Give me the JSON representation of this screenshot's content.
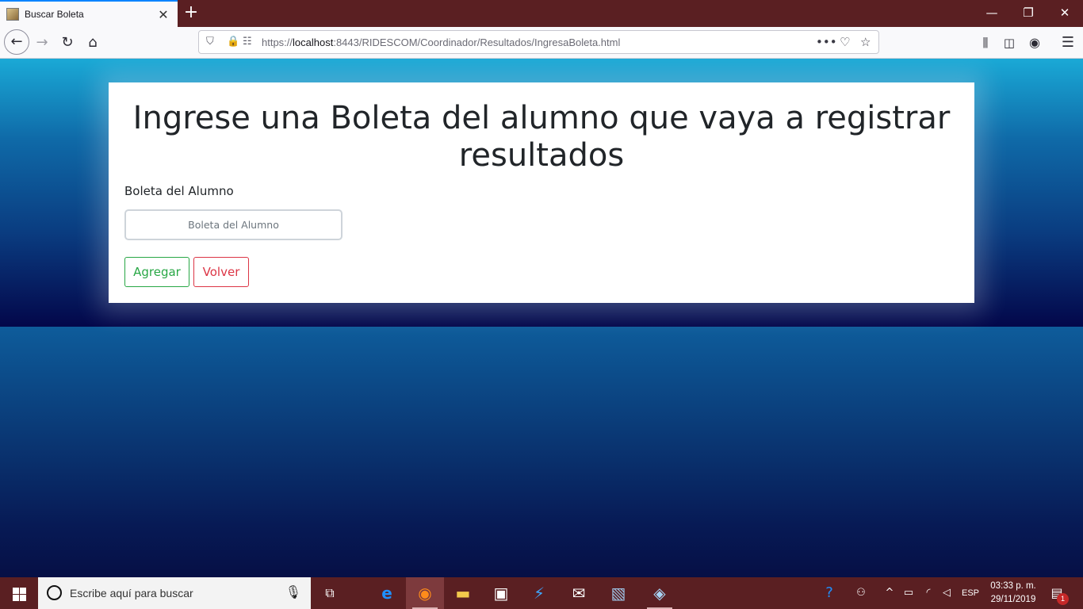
{
  "browser": {
    "tab_title": "Buscar Boleta",
    "tab_close": "✕",
    "new_tab": "+",
    "url_prefix": "https://",
    "url_host": "localhost",
    "url_rest": ":8443/RIDESCOM/Coordinador/Resultados/IngresaBoleta.html",
    "window_controls": {
      "minimize": "—",
      "restore": "❐",
      "close": "✕"
    }
  },
  "form": {
    "title": "Ingrese una Boleta del alumno que vaya a registrar resultados",
    "field_label": "Boleta del Alumno",
    "field_placeholder": "Boleta del Alumno",
    "field_value": "",
    "add_button": "Agregar",
    "back_button": "Volver"
  },
  "taskbar": {
    "search_placeholder": "Escribe aquí para buscar",
    "language": "ESP",
    "time": "03:33 p. m.",
    "date": "29/11/2019",
    "notification_count": "1"
  },
  "colors": {
    "success": "#28a745",
    "danger": "#dc3545",
    "tab_accent": "#0a84ff"
  }
}
